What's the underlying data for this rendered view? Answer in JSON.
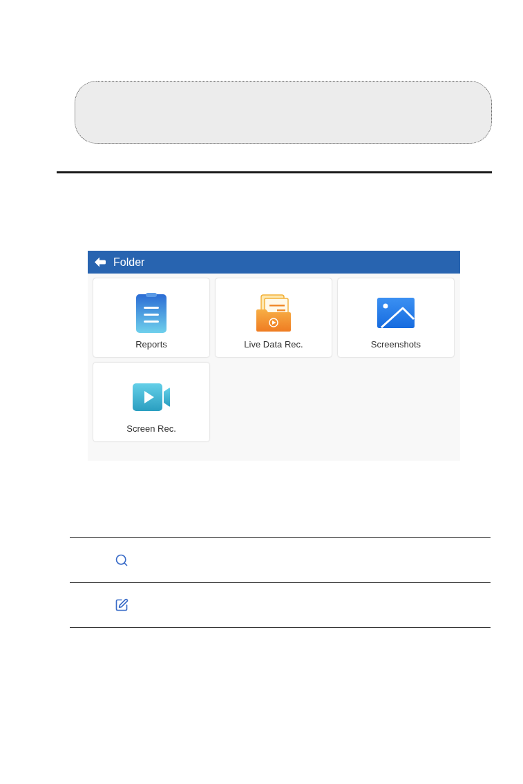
{
  "app_screenshot": {
    "header": {
      "title": "Folder"
    },
    "tiles": [
      {
        "kind": "reports",
        "label": "Reports"
      },
      {
        "kind": "live_data",
        "label": "Live Data Rec."
      },
      {
        "kind": "screenshots",
        "label": "Screenshots"
      },
      {
        "kind": "screen_rec",
        "label": "Screen Rec."
      }
    ]
  },
  "icon_table": {
    "rows": [
      {
        "kind": "search"
      },
      {
        "kind": "edit"
      }
    ]
  }
}
